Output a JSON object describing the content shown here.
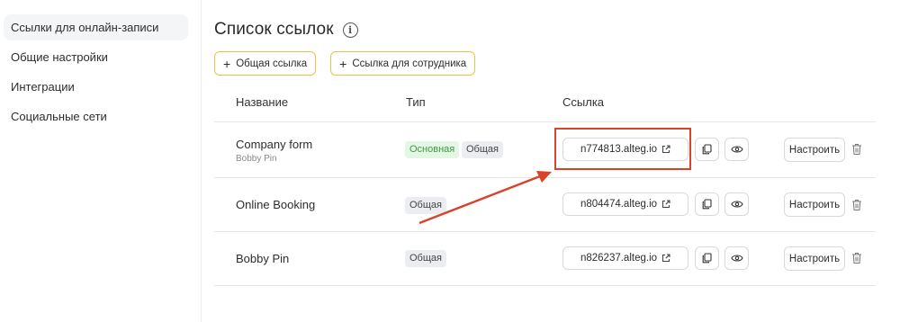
{
  "sidebar": {
    "items": [
      {
        "label": "Ссылки для онлайн-записи",
        "active": true
      },
      {
        "label": "Общие настройки"
      },
      {
        "label": "Интеграции"
      },
      {
        "label": "Социальные сети"
      }
    ]
  },
  "header": {
    "title": "Список ссылок",
    "info_icon": "i"
  },
  "actions": {
    "add_common": "Общая ссылка",
    "add_employee": "Ссылка для сотрудника",
    "plus_icon": "+"
  },
  "table": {
    "columns": [
      "Название",
      "Тип",
      "Ссылка"
    ],
    "rows": [
      {
        "name": "Company form",
        "subname": "Bobby Pin",
        "badges": [
          "Основная",
          "Общая"
        ],
        "link": "n774813.alteg.io",
        "setup": "Настроить"
      },
      {
        "name": "Online Booking",
        "badges": [
          "Общая"
        ],
        "link": "n804474.alteg.io",
        "setup": "Настроить"
      },
      {
        "name": "Bobby Pin",
        "badges": [
          "Общая"
        ],
        "link": "n826237.alteg.io",
        "setup": "Настроить"
      }
    ]
  },
  "colors": {
    "accent_border": "#f0c23b",
    "annotation_red": "#d9432a",
    "badge_main_bg": "#e4f6e4",
    "badge_main_text": "#3d9a47",
    "badge_common_bg": "#ebedf0"
  },
  "icons": {
    "external_link": "external-link-icon",
    "copy": "copy-icon",
    "eye": "eye-icon",
    "trash": "trash-icon",
    "info": "info-icon"
  }
}
